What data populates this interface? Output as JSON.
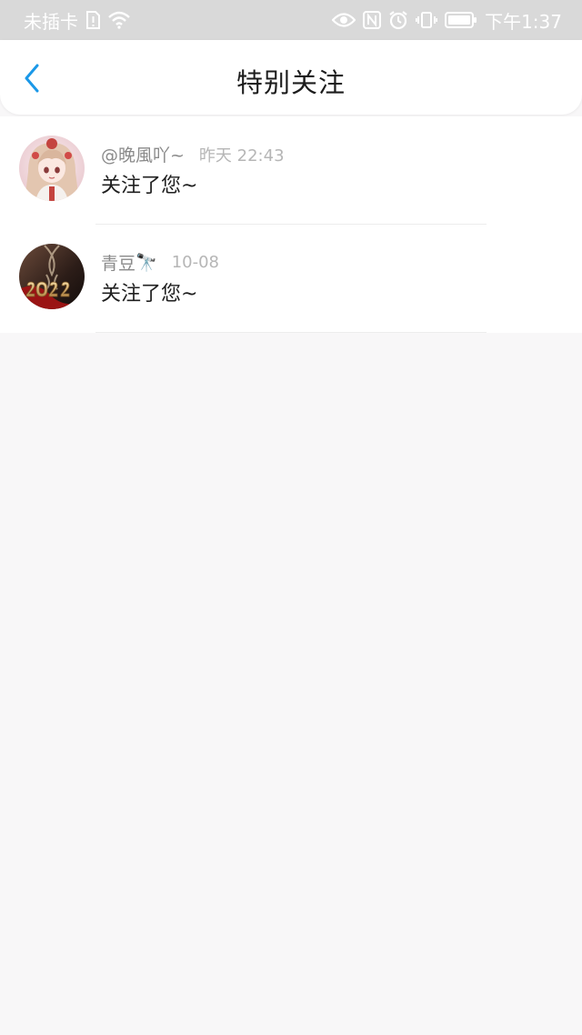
{
  "status_bar": {
    "carrier": "未插卡",
    "time": "下午1:37",
    "icons": [
      "sim-alert-icon",
      "wifi-icon",
      "eye-icon",
      "nfc-icon",
      "alarm-icon",
      "vibrate-icon",
      "battery-icon"
    ]
  },
  "header": {
    "title": "特别关注",
    "back_icon": "chevron-left-icon",
    "accent_color": "#1a98e8"
  },
  "notifications": [
    {
      "username": "@晚風吖~",
      "time": "昨天 22:43",
      "message": "关注了您~",
      "avatar": "anime-girl-avatar"
    },
    {
      "username": "青豆",
      "username_emoji": "🔭",
      "time": "10-08",
      "message": "关注了您~",
      "avatar": "2022-hourglass-avatar"
    }
  ]
}
